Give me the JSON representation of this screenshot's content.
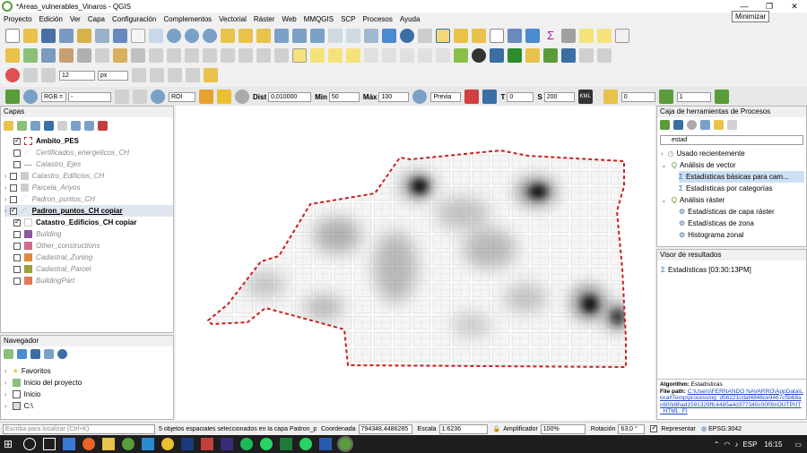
{
  "window": {
    "title": "*Areas_vulnerables_Vinaros - QGIS",
    "tooltip": "Minimizar"
  },
  "menu": [
    "Proyecto",
    "Edición",
    "Ver",
    "Capa",
    "Configuración",
    "Complementos",
    "Vectorial",
    "Ráster",
    "Web",
    "MMQGIS",
    "SCP",
    "Procesos",
    "Ayuda"
  ],
  "scp_toolbar": {
    "rgb": "RGB =",
    "rgb_value": "-",
    "roi": "ROI",
    "dist_label": "Dist",
    "dist": "0,010000",
    "min_label": "Min",
    "min": "50",
    "max_label": "Máx",
    "max": "100",
    "preview": "Previa",
    "t_label": "T",
    "t": "0",
    "s_label": "S",
    "s": "200",
    "kml": "KML",
    "band_a": "0",
    "band_b": "1"
  },
  "layer_toolbar": {
    "size": "12",
    "unit": "px"
  },
  "layers_panel": {
    "title": "Capas",
    "items": [
      {
        "label": "Ambito_PES",
        "checked": true,
        "style": "bold",
        "swatch": "#ffffff"
      },
      {
        "label": "Certificados_energeticos_CH",
        "checked": false,
        "style": "ital"
      },
      {
        "label": "Catastro_Ejes",
        "checked": false,
        "style": "ital"
      },
      {
        "label": "Catastro_Edificios_CH",
        "checked": false,
        "style": "ital"
      },
      {
        "label": "Parcela_Anyos",
        "checked": false,
        "style": "ital"
      },
      {
        "label": "Padron_puntos_CH",
        "checked": false,
        "style": "ital"
      },
      {
        "label": "Padron_puntos_CH copiar",
        "checked": true,
        "style": "bold"
      },
      {
        "label": "Catastro_Edificios_CH copiar",
        "checked": true,
        "style": "bold"
      },
      {
        "label": "Building",
        "checked": false,
        "style": "ital",
        "swatch": "#8b5a9e"
      },
      {
        "label": "Other_constructions",
        "checked": false,
        "style": "ital",
        "swatch": "#d46a8a"
      },
      {
        "label": "Cadastral_Zoning",
        "checked": false,
        "style": "ital",
        "swatch": "#e08a3a"
      },
      {
        "label": "Cadastral_Parcel",
        "checked": false,
        "style": "ital",
        "swatch": "#9aa03a"
      },
      {
        "label": "BuildingPart",
        "checked": false,
        "style": "ital",
        "swatch": "#e0785a"
      }
    ]
  },
  "navigator": {
    "title": "Navegador",
    "items": [
      "Favoritos",
      "Inicio del proyecto",
      "Inicio",
      "C:\\"
    ]
  },
  "processing": {
    "title": "Caja de herramientas de Procesos",
    "search": "estad",
    "items": [
      {
        "label": "Usado recientemente",
        "indent": 0
      },
      {
        "label": "Análisis de vector",
        "indent": 0
      },
      {
        "label": "Estadísticas básicas para cam...",
        "indent": 1
      },
      {
        "label": "Estadísticas por categorías",
        "indent": 1
      },
      {
        "label": "Análisis ráster",
        "indent": 0
      },
      {
        "label": "Estadísticas de capa ráster",
        "indent": 1
      },
      {
        "label": "Estadísticas de zona",
        "indent": 1
      },
      {
        "label": "Histograma zonal",
        "indent": 1
      }
    ]
  },
  "results": {
    "title": "Visor de resultados",
    "item": "Estadísticas [03:30:13PM]",
    "algorithm_label": "Algorithm:",
    "algorithm": "Estadísticas",
    "path_label": "File path:",
    "path": "C:\\Users\\FERNANDO NAVARRO\\AppData\\Local\\Temp\\processing_d56221cdaf4846ce9467c5b68ac600d8\\ad1591329ffc4485a4d377340c00f0b\\OUTPUT_HTML_FI"
  },
  "status": {
    "search_placeholder": "Escriba para localizar (Ctrl+K)",
    "message": "5 objetos espaciales seleccionados en la capa Padron_p",
    "coord_label": "Coordenada",
    "coord": "794348,4486285",
    "scale_label": "Escala",
    "scale": "1:6236",
    "mag_label": "Amplificador",
    "mag": "100%",
    "rot_label": "Rotación",
    "rot": "63,0 °",
    "render": "Representar",
    "crs": "EPSG:3042"
  },
  "taskbar": {
    "lang": "ESP",
    "time": "16:15"
  },
  "colors": {
    "boundary": "#cc1f1f",
    "accent": "#3a6ea5"
  }
}
